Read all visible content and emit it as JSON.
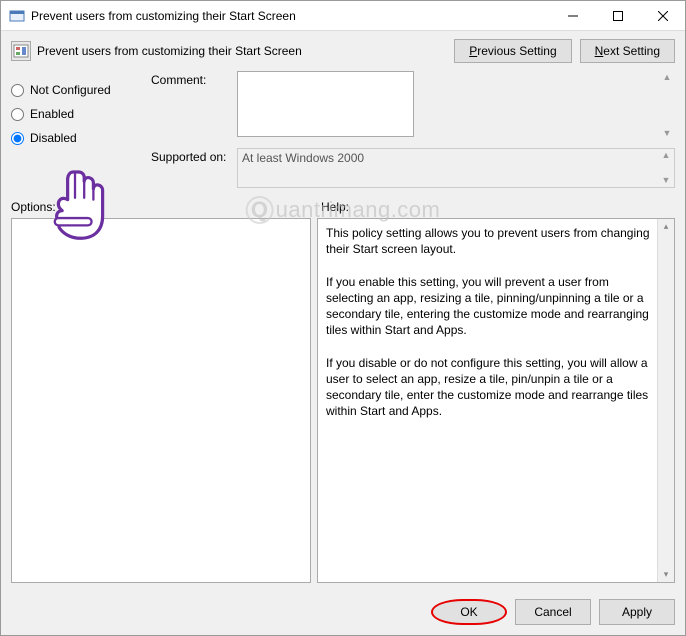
{
  "window": {
    "title": "Prevent users from customizing their Start Screen"
  },
  "header": {
    "policy_title": "Prevent users from customizing their Start Screen",
    "prev_btn": "Previous Setting",
    "next_btn": "Next Setting"
  },
  "radios": {
    "not_configured": "Not Configured",
    "enabled": "Enabled",
    "disabled": "Disabled",
    "selected": "disabled"
  },
  "fields": {
    "comment_label": "Comment:",
    "comment_value": "",
    "supported_label": "Supported on:",
    "supported_value": "At least Windows 2000"
  },
  "sections": {
    "options_label": "Options:",
    "help_label": "Help:"
  },
  "help_text": "This policy setting allows you to prevent users from changing their Start screen layout.\n\nIf you enable this setting, you will prevent a user from selecting an app, resizing a tile, pinning/unpinning a tile or a secondary tile, entering the customize mode and rearranging tiles within Start and Apps.\n\nIf you disable or do not configure this setting, you will allow a user to select an app, resize a tile, pin/unpin a tile or a secondary tile, enter the customize mode and rearrange tiles within Start and Apps.",
  "footer": {
    "ok": "OK",
    "cancel": "Cancel",
    "apply": "Apply"
  },
  "watermark": "uantrimang.com"
}
